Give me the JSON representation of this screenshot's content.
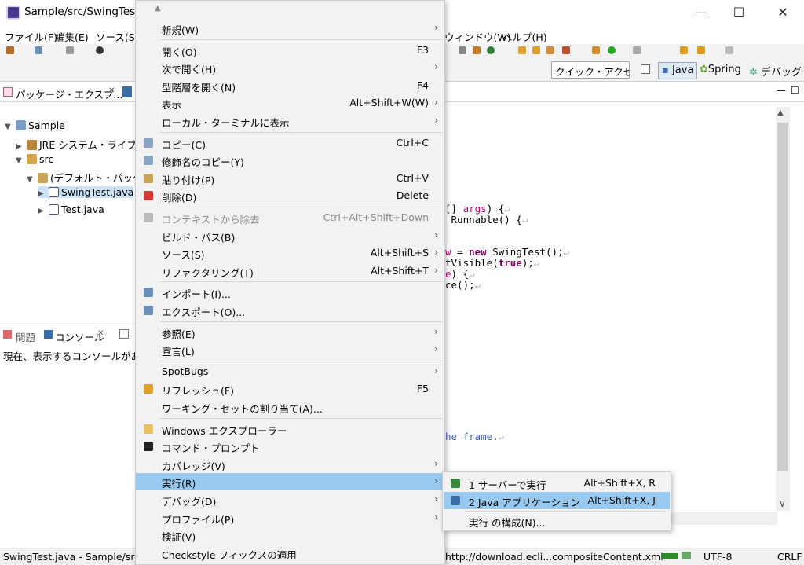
{
  "window": {
    "title": "Sample/src/SwingTest.j",
    "minimize": "—",
    "maximize": "☐",
    "close": "✕"
  },
  "menubar": {
    "left": [
      "ファイル(F)",
      "編集(E)",
      "ソース(S)"
    ],
    "right": [
      "ウィンドウ(W)",
      "ヘルプ(H)"
    ]
  },
  "toolbar": {
    "quick_access": "クイック・アクセス",
    "perspectives": [
      "Java",
      "Spring",
      "デバッグ"
    ]
  },
  "package_explorer": {
    "tab_label": "パッケージ・エクスプ...",
    "tab_close": "✕",
    "tree": [
      {
        "label": "Sample",
        "depth": 0,
        "expanded": true
      },
      {
        "label": "JRE システム・ライブラリ",
        "depth": 1,
        "expanded": false
      },
      {
        "label": "src",
        "depth": 1,
        "expanded": true
      },
      {
        "label": "(デフォルト・パッケージ)",
        "depth": 2,
        "expanded": true
      },
      {
        "label": "SwingTest.java",
        "depth": 3,
        "expanded": false,
        "selected": true
      },
      {
        "label": "Test.java",
        "depth": 3,
        "expanded": false
      }
    ]
  },
  "console": {
    "tabs": [
      "問題",
      "コンソール"
    ],
    "message": "現在、表示するコンソールがあり"
  },
  "editor": {
    "lines": [
      {
        "plain": "[] ",
        "var": "args",
        "tail": ") {"
      },
      {
        "plain": " Runnable() {"
      },
      {
        "prefix": "",
        "var": "w",
        "mid": " = ",
        "kw": "new",
        "tail": " SwingTest();"
      },
      {
        "plain": "tVisible(",
        "kw": "true",
        "tail": ");"
      },
      {
        "var": "e",
        "tail": ") {"
      },
      {
        "plain": "ce();"
      },
      {
        "comment": "he frame."
      }
    ]
  },
  "context_menu": {
    "items": [
      {
        "label": "新規(W)",
        "submenu": true
      },
      {
        "sep": true
      },
      {
        "label": "開く(O)",
        "shortcut": "F3"
      },
      {
        "label": "次で開く(H)",
        "submenu": true
      },
      {
        "label": "型階層を開く(N)",
        "shortcut": "F4"
      },
      {
        "label": "表示",
        "shortcut": "Alt+Shift+W(W)",
        "submenu": true
      },
      {
        "label": "ローカル・ターミナルに表示",
        "submenu": true
      },
      {
        "sep": true
      },
      {
        "label": "コピー(C)",
        "shortcut": "Ctrl+C",
        "icon": "copy-icon"
      },
      {
        "label": "修飾名のコピー(Y)",
        "icon": "copy-qualified-icon"
      },
      {
        "label": "貼り付け(P)",
        "shortcut": "Ctrl+V",
        "icon": "paste-icon"
      },
      {
        "label": "削除(D)",
        "shortcut": "Delete",
        "icon": "delete-icon"
      },
      {
        "sep": true
      },
      {
        "label": "コンテキストから除去",
        "shortcut": "Ctrl+Alt+Shift+Down",
        "disabled": true,
        "icon": "remove-context-icon"
      },
      {
        "label": "ビルド・パス(B)",
        "submenu": true
      },
      {
        "label": "ソース(S)",
        "shortcut": "Alt+Shift+S",
        "submenu": true
      },
      {
        "label": "リファクタリング(T)",
        "shortcut": "Alt+Shift+T",
        "submenu": true
      },
      {
        "sep": true
      },
      {
        "label": "インポート(I)...",
        "icon": "import-icon"
      },
      {
        "label": "エクスポート(O)...",
        "icon": "export-icon"
      },
      {
        "sep": true
      },
      {
        "label": "参照(E)",
        "submenu": true
      },
      {
        "label": "宣言(L)",
        "submenu": true
      },
      {
        "sep": true
      },
      {
        "label": "SpotBugs",
        "submenu": true
      },
      {
        "label": "リフレッシュ(F)",
        "shortcut": "F5",
        "icon": "refresh-icon"
      },
      {
        "label": "ワーキング・セットの割り当て(A)..."
      },
      {
        "sep": true
      },
      {
        "label": "Windows エクスプローラー",
        "icon": "explorer-icon"
      },
      {
        "label": "コマンド・プロンプト",
        "icon": "terminal-icon"
      },
      {
        "label": "カバレッジ(V)",
        "submenu": true
      },
      {
        "label": "実行(R)",
        "submenu": true,
        "highlighted": true
      },
      {
        "label": "デバッグ(D)",
        "submenu": true
      },
      {
        "label": "プロファイル(P)",
        "submenu": true
      },
      {
        "label": "検証(V)"
      },
      {
        "label": "Checkstyle フィックスの適用"
      }
    ]
  },
  "run_submenu": {
    "items": [
      {
        "label": "1 サーバーで実行",
        "shortcut": "Alt+Shift+X, R",
        "icon": "server-run-icon"
      },
      {
        "label": "2 Java アプリケーション",
        "shortcut": "Alt+Shift+X, J",
        "icon": "java-app-icon",
        "highlighted": true
      },
      {
        "sep": true
      },
      {
        "label": "実行 の構成(N)..."
      }
    ]
  },
  "statusbar": {
    "left": "SwingTest.java - Sample/src",
    "url": "http://download.ecli...compositeContent.xml",
    "encoding": "UTF-8",
    "line_ending": "CRLF"
  },
  "colors": {
    "highlight": "#99c9ef",
    "menu_bg": "#f2f2f2",
    "keyword": "#7f0055",
    "comment": "#3f5fbf"
  }
}
